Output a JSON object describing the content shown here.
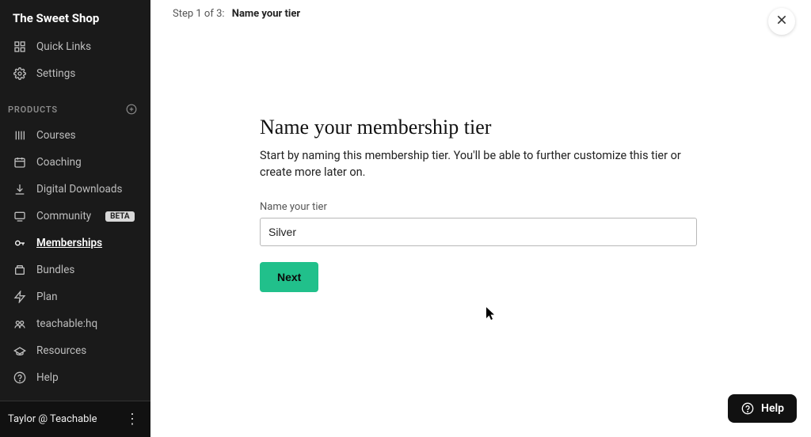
{
  "sidebar": {
    "brand": "The Sweet Shop",
    "topItems": [
      {
        "label": "Quick Links",
        "icon": "grid-icon"
      },
      {
        "label": "Settings",
        "icon": "gear-icon"
      }
    ],
    "productsHeader": "PRODUCTS",
    "productItems": [
      {
        "label": "Courses",
        "icon": "courses-icon",
        "badge": null,
        "active": false
      },
      {
        "label": "Coaching",
        "icon": "calendar-icon",
        "badge": null,
        "active": false
      },
      {
        "label": "Digital Downloads",
        "icon": "download-icon",
        "badge": null,
        "active": false
      },
      {
        "label": "Community",
        "icon": "community-icon",
        "badge": "BETA",
        "active": false
      },
      {
        "label": "Memberships",
        "icon": "key-icon",
        "badge": null,
        "active": true
      },
      {
        "label": "Bundles",
        "icon": "bundles-icon",
        "badge": null,
        "active": false
      },
      {
        "label": "Plan",
        "icon": "plan-icon",
        "badge": null,
        "active": false
      },
      {
        "label": "teachable:hq",
        "icon": "hq-icon",
        "badge": null,
        "active": false
      },
      {
        "label": "Resources",
        "icon": "resources-icon",
        "badge": null,
        "active": false
      },
      {
        "label": "Help",
        "icon": "help-icon",
        "badge": null,
        "active": false
      }
    ],
    "footerUser": "Taylor @ Teachable"
  },
  "wizard": {
    "stepLabel": "Step 1 of 3:",
    "stepTitle": "Name your tier",
    "heading": "Name your membership tier",
    "description": "Start by naming this membership tier. You'll be able to further customize this tier or create more later on.",
    "fieldLabel": "Name your tier",
    "fieldValue": "Silver",
    "nextLabel": "Next"
  },
  "helpWidget": {
    "label": "Help"
  }
}
